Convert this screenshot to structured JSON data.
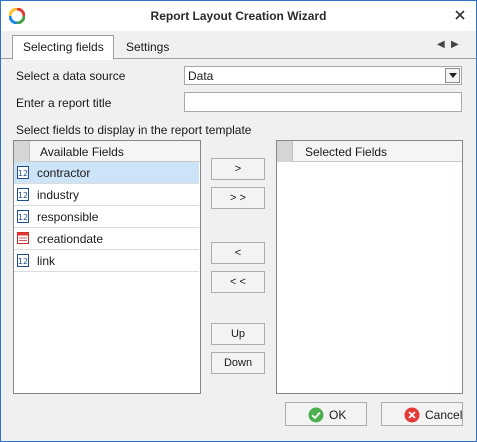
{
  "window": {
    "title": "Report Layout Creation Wizard"
  },
  "tabs": [
    {
      "label": "Selecting fields",
      "active": true
    },
    {
      "label": "Settings",
      "active": false
    }
  ],
  "form": {
    "data_source_label": "Select a data source",
    "data_source_value": "Data",
    "report_title_label": "Enter a report title",
    "report_title_value": "",
    "fields_hint": "Select fields to display in the report template"
  },
  "available": {
    "header": "Available Fields",
    "items": [
      {
        "label": "contractor",
        "icon": "numeric-field-icon",
        "selected": true
      },
      {
        "label": "industry",
        "icon": "numeric-field-icon",
        "selected": false
      },
      {
        "label": "responsible",
        "icon": "numeric-field-icon",
        "selected": false
      },
      {
        "label": "creationdate",
        "icon": "date-field-icon",
        "selected": false
      },
      {
        "label": "link",
        "icon": "numeric-field-icon",
        "selected": false
      }
    ]
  },
  "selected": {
    "header": "Selected Fields",
    "items": []
  },
  "transfer": {
    "add_one": ">",
    "add_all": "> >",
    "remove_one": "<",
    "remove_all": "< <",
    "up": "Up",
    "down": "Down"
  },
  "footer": {
    "ok": "OK",
    "cancel": "Cancel"
  },
  "colors": {
    "window_border": "#2b74c9",
    "selection": "#cde3f7",
    "ok_icon": "#4caf50",
    "cancel_icon": "#e53935"
  }
}
